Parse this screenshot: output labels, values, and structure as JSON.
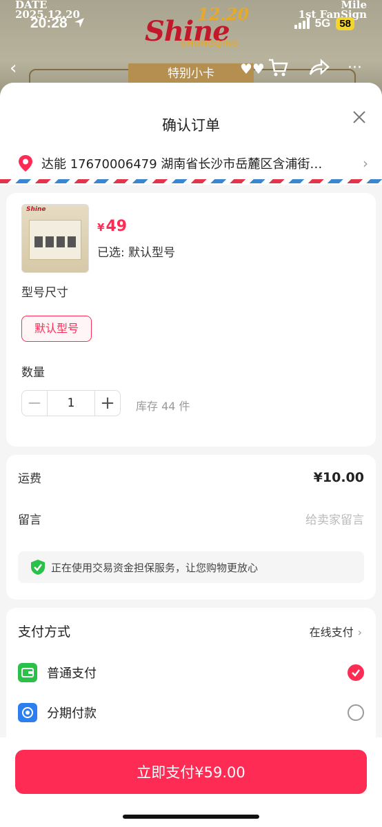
{
  "status_bar": {
    "time": "20:28",
    "network": "5G",
    "battery": "58"
  },
  "background": {
    "date_label": "DATE",
    "date_value": "2025.12.20",
    "logo_text": "Shine",
    "logo_number": "12.20",
    "logo_city": "CHONGQING",
    "top_right_1": "Mile",
    "top_right_2": "1st FanSign",
    "tag": "特别小卡"
  },
  "sheet": {
    "title": "确认订单",
    "address": "达能 17670006479 湖南省长沙市岳麓区含浦街…"
  },
  "product": {
    "currency": "¥",
    "price": "49",
    "selected": "已选: 默认型号",
    "spec_label": "型号尺寸",
    "spec_option": "默认型号",
    "qty_label": "数量",
    "quantity": "1",
    "stock": "库存 44 件"
  },
  "order": {
    "shipping_label": "运费",
    "shipping_fee": "¥10.00",
    "message_label": "留言",
    "message_placeholder": "给卖家留言",
    "guarantee": "正在使用交易资金担保服务，让您购物更放心"
  },
  "payment": {
    "title": "支付方式",
    "mode": "在线支付",
    "options": [
      {
        "label": "普通支付",
        "selected": true
      },
      {
        "label": "分期付款",
        "selected": false
      }
    ]
  },
  "footer": {
    "pay_button": "立即支付¥59.00"
  },
  "colors": {
    "accent": "#fe2c55",
    "wallet_icon": "#2bc04a",
    "installment_icon": "#2d7ff0",
    "guarantee_icon": "#2bc04a"
  }
}
